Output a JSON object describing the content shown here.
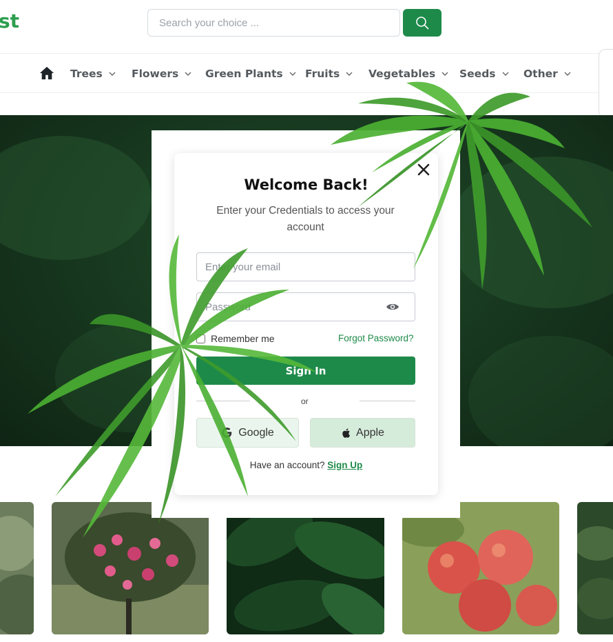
{
  "header": {
    "logo_text": "st",
    "search_placeholder": "Search your choice ...",
    "search_icon": "search-icon"
  },
  "nav": {
    "home_icon": "home-icon",
    "items": [
      {
        "label": "Trees"
      },
      {
        "label": "Flowers"
      },
      {
        "label": "Green Plants"
      },
      {
        "label": "Fruits"
      },
      {
        "label": "Vegetables"
      },
      {
        "label": "Seeds"
      },
      {
        "label": "Other"
      }
    ]
  },
  "modal": {
    "title": "Welcome Back!",
    "subtitle": "Enter your Credentials to access your account",
    "email_placeholder": "Enter your email",
    "password_placeholder": "Password",
    "remember_label": "Remember me",
    "forgot_label": "Forgot Password?",
    "signin_label": "Sign In",
    "or_label": "or",
    "google_label": "Google",
    "apple_label": "Apple",
    "have_account_text": "Have an account?",
    "signup_label": "Sign Up"
  },
  "colors": {
    "brand": "#1e8a4a",
    "social_bg": "#eaf6ed"
  }
}
